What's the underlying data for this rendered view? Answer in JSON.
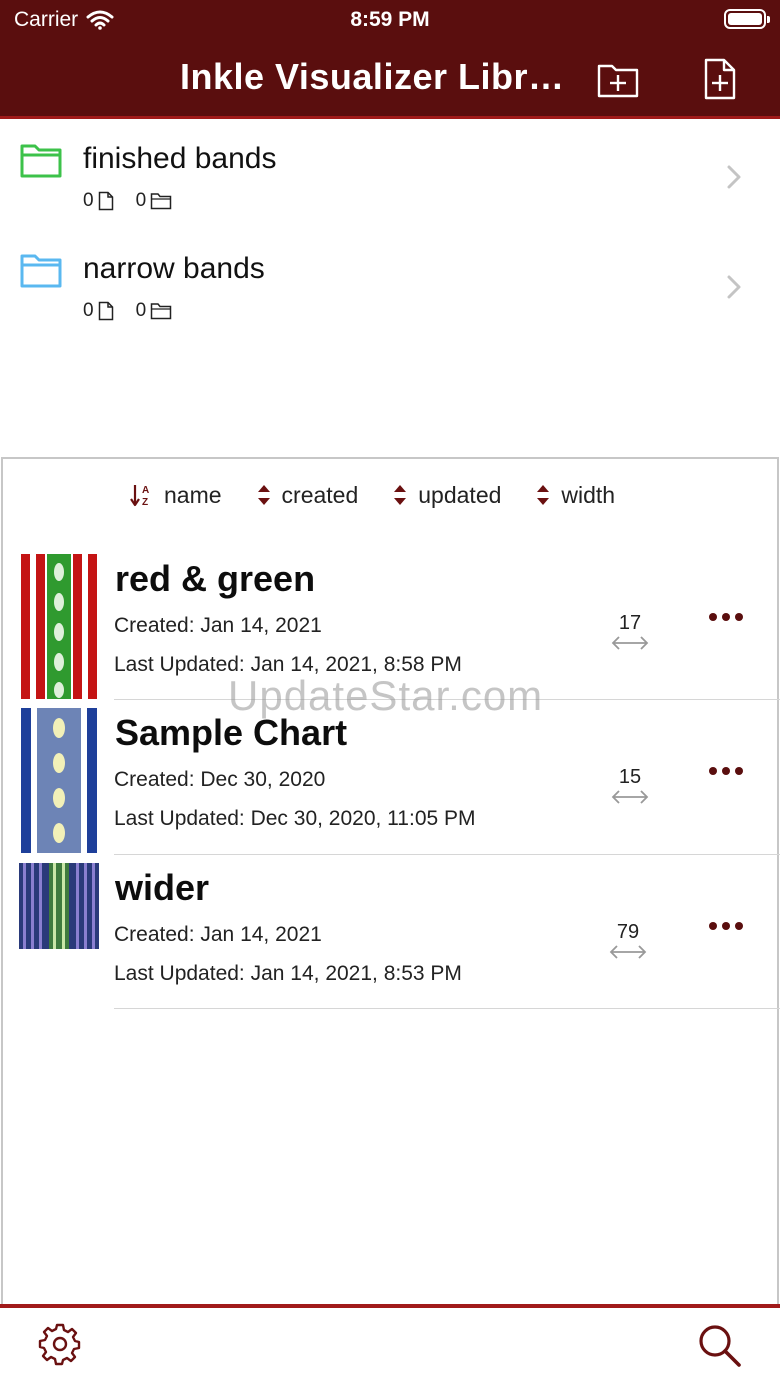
{
  "status_bar": {
    "carrier": "Carrier",
    "time": "8:59 PM"
  },
  "header": {
    "title": "Inkle Visualizer Libr…"
  },
  "folders": [
    {
      "name": "finished bands",
      "file_count": "0",
      "folder_count": "0",
      "color": "#3cc24a"
    },
    {
      "name": "narrow bands",
      "file_count": "0",
      "folder_count": "0",
      "color": "#5ab8f0"
    }
  ],
  "sort_options": [
    "name",
    "created",
    "updated",
    "width"
  ],
  "charts": [
    {
      "name": "red & green",
      "created": "Created: Jan 14, 2021",
      "updated": "Last Updated: Jan 14, 2021, 8:58 PM",
      "width": "17"
    },
    {
      "name": "Sample Chart",
      "created": "Created: Dec 30, 2020",
      "updated": "Last Updated: Dec 30, 2020, 11:05 PM",
      "width": "15"
    },
    {
      "name": "wider",
      "created": "Created: Jan 14, 2021",
      "updated": "Last Updated: Jan 14, 2021, 8:53 PM",
      "width": "79"
    }
  ],
  "watermark": "UpdateStar.com",
  "colors": {
    "header_bg": "#5a0e0e",
    "accent": "#a11a1a"
  }
}
